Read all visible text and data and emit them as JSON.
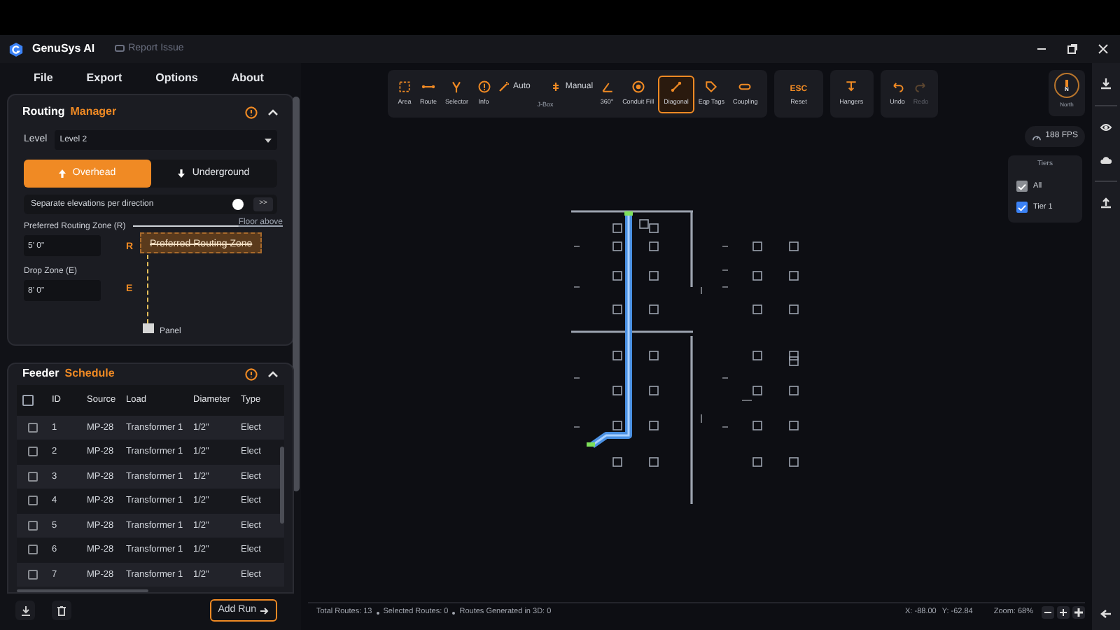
{
  "window": {
    "title": "GenuSys AI",
    "report_link": "Report Issue"
  },
  "menu": [
    {
      "label": "File"
    },
    {
      "label": "Export"
    },
    {
      "label": "Options"
    },
    {
      "label": "About"
    }
  ],
  "routing_manager": {
    "title": "Routing",
    "title_accent": "Manager",
    "expanded": true,
    "level": {
      "label": "Level",
      "value": "Level 2"
    },
    "modes": [
      {
        "label": "Overhead",
        "selected": true
      },
      {
        "label": "Underground",
        "selected": false
      }
    ],
    "separate_elevations": {
      "label": "Separate elevations per direction",
      "on": true,
      "button": ">>"
    },
    "preferred_zone": {
      "label": "Preferred Routing Zone (R)",
      "value": "5' 0\""
    },
    "drop_zone": {
      "label": "Drop Zone (E)",
      "value": "8' 0\""
    },
    "diagram": {
      "floor_label": "Floor above",
      "r_letter": "R",
      "e_letter": "E",
      "zone_label": "Preferred Routing Zone",
      "panel_label": "Panel"
    }
  },
  "feeder_schedule": {
    "title": "Feeder",
    "title_accent": "Schedule",
    "expanded": true,
    "select_all_checked": false,
    "columns": [
      "ID",
      "Source",
      "Load",
      "Diameter",
      "Type"
    ],
    "rows": [
      {
        "checked": false,
        "cells": [
          "1",
          "MP-28",
          "Transformer 1",
          "1/2\"",
          "Elect"
        ]
      },
      {
        "checked": false,
        "cells": [
          "2",
          "MP-28",
          "Transformer 1",
          "1/2\"",
          "Elect"
        ]
      },
      {
        "checked": false,
        "cells": [
          "3",
          "MP-28",
          "Transformer 1",
          "1/2\"",
          "Elect"
        ]
      },
      {
        "checked": false,
        "cells": [
          "4",
          "MP-28",
          "Transformer 1",
          "1/2\"",
          "Elect"
        ]
      },
      {
        "checked": false,
        "cells": [
          "5",
          "MP-28",
          "Transformer 1",
          "1/2\"",
          "Elect"
        ]
      },
      {
        "checked": false,
        "cells": [
          "6",
          "MP-28",
          "Transformer 1",
          "1/2\"",
          "Elect"
        ]
      },
      {
        "checked": false,
        "cells": [
          "7",
          "MP-28",
          "Transformer 1",
          "1/2\"",
          "Elect"
        ]
      }
    ],
    "add_button": "Add Run"
  },
  "toolbar": {
    "groups": [
      {
        "items": [
          {
            "kind": "tool",
            "label": "Area",
            "selected": false,
            "disabled": false
          },
          {
            "kind": "tool",
            "label": "Route",
            "selected": false,
            "disabled": false
          },
          {
            "kind": "tool",
            "label": "Selector",
            "selected": false,
            "disabled": false
          },
          {
            "kind": "tool",
            "label": "Info",
            "selected": false,
            "disabled": false
          },
          {
            "kind": "jbox",
            "label": "J-Box",
            "options": [
              "Auto",
              "Manual"
            ]
          },
          {
            "kind": "tool",
            "label": "360°",
            "selected": false,
            "disabled": false
          },
          {
            "kind": "tool",
            "label": "Conduit Fill",
            "selected": false,
            "disabled": false
          },
          {
            "kind": "tool",
            "label": "Diagonal",
            "selected": true,
            "disabled": false
          },
          {
            "kind": "tool",
            "label": "Eqp Tags",
            "selected": false,
            "disabled": false
          },
          {
            "kind": "tool",
            "label": "Coupling",
            "selected": false,
            "disabled": false
          }
        ]
      },
      {
        "items": [
          {
            "kind": "key",
            "key": "ESC",
            "label": "Reset",
            "selected": false,
            "disabled": false
          }
        ]
      },
      {
        "items": [
          {
            "kind": "tool",
            "label": "Hangers",
            "selected": false,
            "disabled": false
          }
        ]
      },
      {
        "items": [
          {
            "kind": "tool",
            "label": "Undo",
            "selected": false,
            "disabled": false
          },
          {
            "kind": "tool",
            "label": "Redo",
            "selected": false,
            "disabled": true
          }
        ]
      }
    ]
  },
  "compass": {
    "letter": "N",
    "label": "North"
  },
  "fps": "188 FPS",
  "tiers": {
    "title": "Tiers",
    "items": [
      {
        "label": "All",
        "checked": true,
        "color": "#8a8d93"
      },
      {
        "label": "Tier 1",
        "checked": true,
        "color": "#3b82f6"
      }
    ]
  },
  "status_bar": {
    "stats": [
      "Total Routes: 13",
      "Selected Routes: 0",
      "Routes Generated in 3D: 0"
    ],
    "x": "X: -88.00",
    "y": "Y: -62.84",
    "zoom": "Zoom: 68%"
  }
}
